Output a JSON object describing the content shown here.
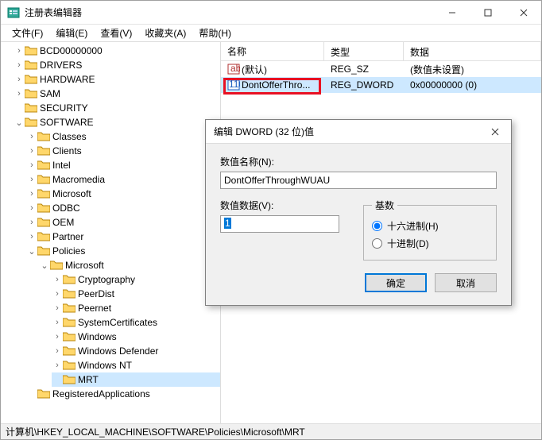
{
  "window": {
    "title": "注册表编辑器"
  },
  "menu": {
    "file": "文件(F)",
    "edit": "编辑(E)",
    "view": "查看(V)",
    "favorites": "收藏夹(A)",
    "help": "帮助(H)"
  },
  "tree": {
    "n_bcd": "BCD00000000",
    "n_drivers": "DRIVERS",
    "n_hardware": "HARDWARE",
    "n_sam": "SAM",
    "n_security": "SECURITY",
    "n_software": "SOFTWARE",
    "n_classes": "Classes",
    "n_clients": "Clients",
    "n_intel": "Intel",
    "n_macromedia": "Macromedia",
    "n_microsoft": "Microsoft",
    "n_odbc": "ODBC",
    "n_oem": "OEM",
    "n_partner": "Partner",
    "n_policies": "Policies",
    "n_pol_microsoft": "Microsoft",
    "n_cryptography": "Cryptography",
    "n_peerdist": "PeerDist",
    "n_peernet": "Peernet",
    "n_systemcerts": "SystemCertificates",
    "n_windows": "Windows",
    "n_windef": "Windows Defender",
    "n_winnt": "Windows NT",
    "n_mrt": "MRT",
    "n_regapps": "RegisteredApplications"
  },
  "list": {
    "hdr_name": "名称",
    "hdr_type": "类型",
    "hdr_data": "数据",
    "row0_name": "(默认)",
    "row0_type": "REG_SZ",
    "row0_data": "(数值未设置)",
    "row1_name": "DontOfferThro...",
    "row1_type": "REG_DWORD",
    "row1_data": "0x00000000 (0)"
  },
  "dialog": {
    "title": "编辑 DWORD (32 位)值",
    "name_label": "数值名称(N):",
    "name_value": "DontOfferThroughWUAU",
    "data_label": "数值数据(V):",
    "data_value": "1",
    "base_label": "基数",
    "radix_hex": "十六进制(H)",
    "radix_dec": "十进制(D)",
    "ok": "确定",
    "cancel": "取消"
  },
  "status": {
    "path": "计算机\\HKEY_LOCAL_MACHINE\\SOFTWARE\\Policies\\Microsoft\\MRT"
  }
}
